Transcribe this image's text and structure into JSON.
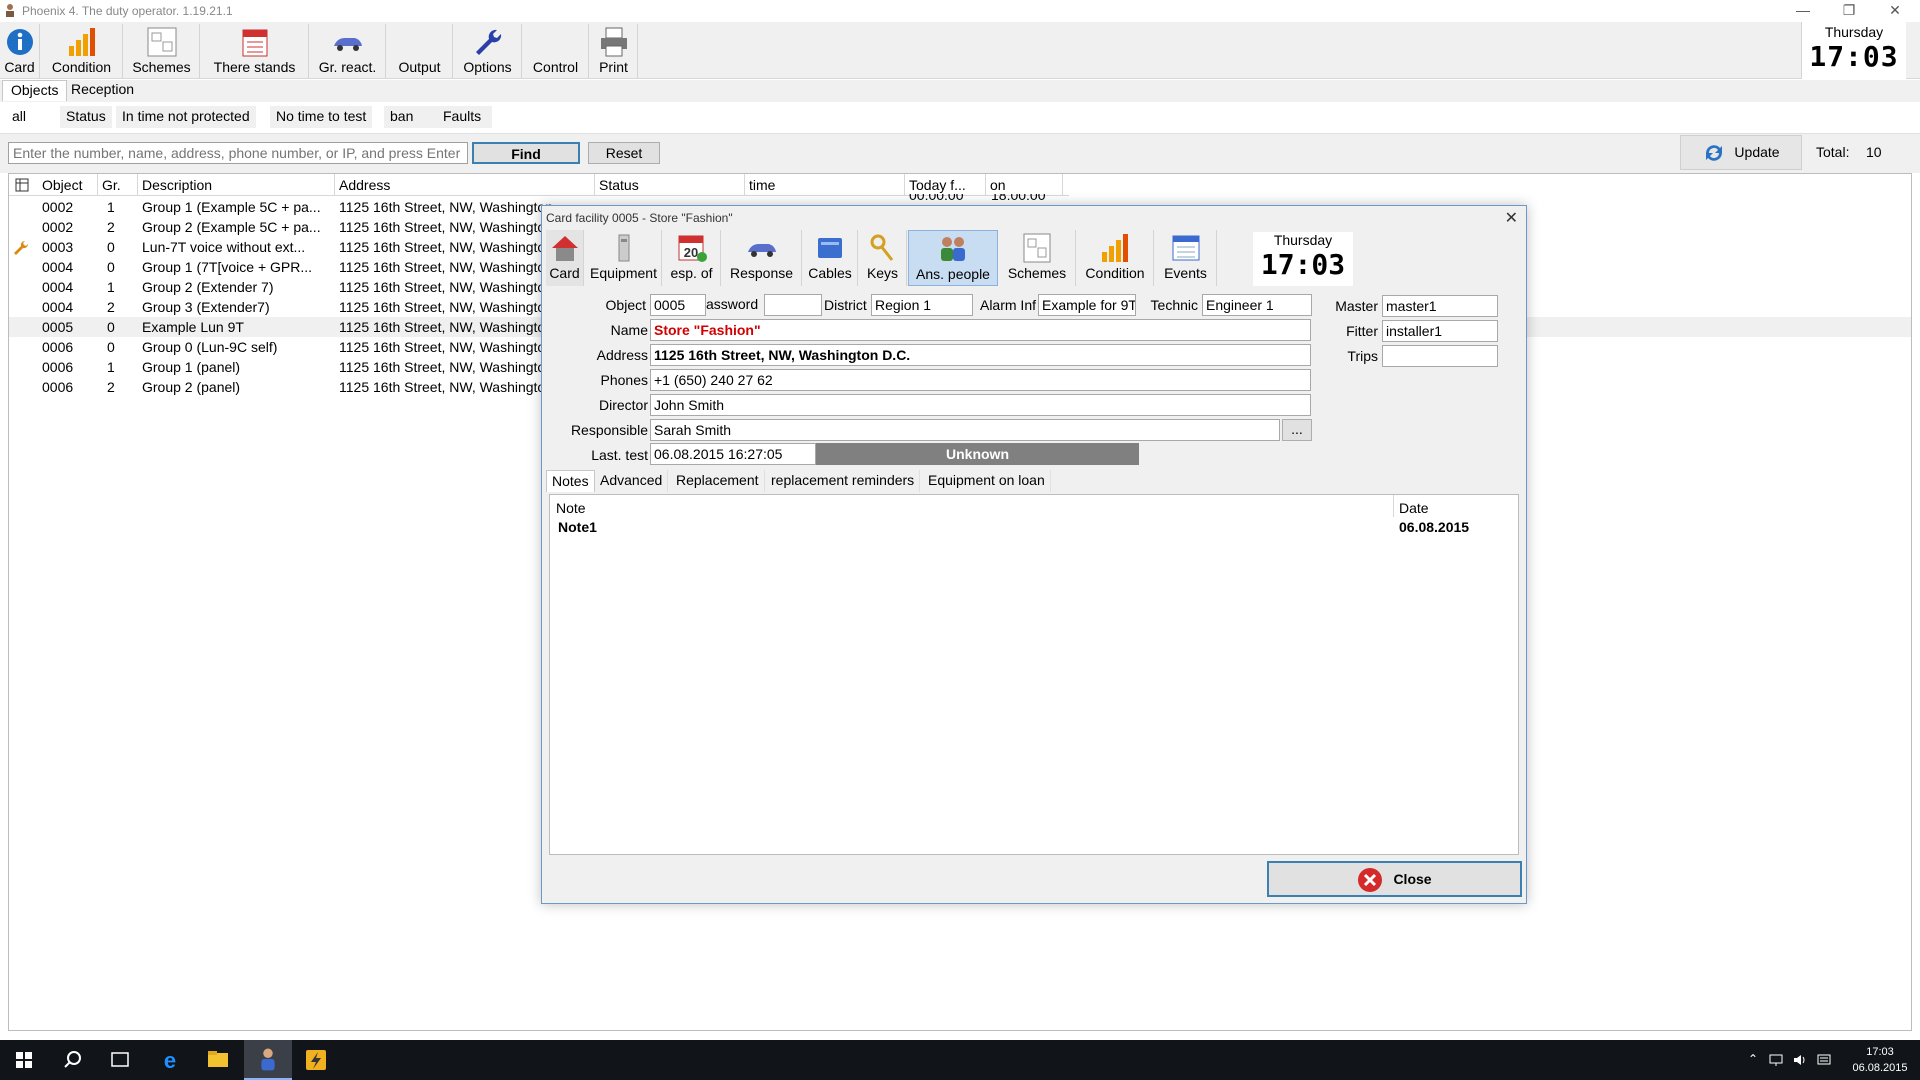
{
  "window": {
    "title": "Phoenix 4. The duty operator. 1.19.21.1"
  },
  "ribbon": {
    "buttons": [
      "Card",
      "Condition",
      "Schemes",
      "There stands",
      "Gr. react.",
      "Output",
      "Options",
      "Control",
      "Print"
    ],
    "day": "Thursday",
    "time": "17:03"
  },
  "main_tabs": [
    "Objects",
    "Reception"
  ],
  "filter_tabs": [
    "all",
    "Status",
    "In time not protected",
    "No time to test",
    "ban",
    "Faults"
  ],
  "search": {
    "placeholder": "Enter the number, name, address, phone number, or IP, and press Enter",
    "find_label": "Find",
    "reset_label": "Reset",
    "update_label": "Update",
    "total_label": "Total:",
    "total_value": "10"
  },
  "grid": {
    "columns": [
      "Object",
      "Gr.",
      "Description",
      "Address",
      "Status",
      "time",
      "Today f...",
      "on"
    ],
    "visible_time_fragments": [
      "00:00:00",
      "18:00:00"
    ],
    "rows": [
      {
        "object": "0002",
        "gr": "1",
        "description": "Group 1 (Example 5C + pa...",
        "address": "1125 16th Street, NW, Washington"
      },
      {
        "object": "0002",
        "gr": "2",
        "description": "Group 2 (Example 5C + pa...",
        "address": "1125 16th Street, NW, Washington"
      },
      {
        "object": "0003",
        "gr": "0",
        "description": "Lun-7T voice without ext...",
        "address": "1125 16th Street, NW, Washington"
      },
      {
        "object": "0004",
        "gr": "0",
        "description": "Group 1 (7T[voice + GPR...",
        "address": "1125 16th Street, NW, Washington"
      },
      {
        "object": "0004",
        "gr": "1",
        "description": "Group 2 (Extender 7)",
        "address": "1125 16th Street, NW, Washington"
      },
      {
        "object": "0004",
        "gr": "2",
        "description": "Group 3 (Extender7)",
        "address": "1125 16th Street, NW, Washington"
      },
      {
        "object": "0005",
        "gr": "0",
        "description": "Example Lun 9T",
        "address": "1125 16th Street, NW, Washington"
      },
      {
        "object": "0006",
        "gr": "0",
        "description": "Group 0 (Lun-9C self)",
        "address": "1125 16th Street, NW, Washington"
      },
      {
        "object": "0006",
        "gr": "1",
        "description": "Group 1 (panel)",
        "address": "1125 16th Street, NW, Washington"
      },
      {
        "object": "0006",
        "gr": "2",
        "description": "Group 2 (panel)",
        "address": "1125 16th Street, NW, Washington"
      }
    ]
  },
  "dialog": {
    "title": "Card facility  0005 - Store \"Fashion\"",
    "toolbar": [
      "Card",
      "Equipment",
      "esp. of",
      "Response",
      "Cables",
      "Keys",
      "Ans. people",
      "Schemes",
      "Condition",
      "Events"
    ],
    "calendar_number": "20",
    "day": "Thursday",
    "time": "17:03",
    "labels": {
      "object": "Object",
      "password": "assword",
      "district": "District",
      "alarm": "Alarm Inf",
      "technic": "Technic",
      "master": "Master",
      "fitter": "Fitter",
      "trips": "Trips",
      "name": "Name",
      "address": "Address",
      "phones": "Phones",
      "director": "Director",
      "responsible": "Responsible",
      "last_test": "Last. test"
    },
    "values": {
      "object": "0005",
      "password": "",
      "district": "Region 1",
      "alarm": "Example for 9T",
      "technic": "Engineer 1",
      "master": "master1",
      "fitter": "installer1",
      "trips": "",
      "name": "Store \"Fashion\"",
      "address": "1125 16th Street, NW, Washington D.C.",
      "phones": "+1 (650) 240 27 62",
      "director": "John Smith",
      "responsible": "Sarah Smith",
      "last_test": "06.08.2015 16:27:05",
      "status": "Unknown",
      "more": "..."
    },
    "tabs": [
      "Notes",
      "Advanced",
      "Replacement",
      "replacement reminders",
      "Equipment on loan"
    ],
    "notes": {
      "col_note": "Note",
      "col_date": "Date",
      "rows": [
        {
          "note": "Note1",
          "date": "06.08.2015"
        }
      ]
    },
    "close_label": "Close"
  },
  "taskbar": {
    "time": "17:03",
    "date": "06.08.2015"
  },
  "colors": {
    "accent": "#3c7fb1",
    "name_red": "#d00000",
    "status_gray": "#808080",
    "active_tab": "#c9ddf2"
  }
}
